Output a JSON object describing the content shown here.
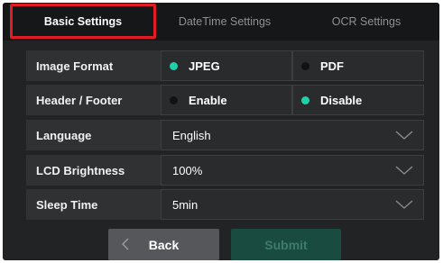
{
  "tabs": [
    {
      "label": "Basic Settings",
      "active": true
    },
    {
      "label": "DateTime Settings",
      "active": false
    },
    {
      "label": "OCR Settings",
      "active": false
    }
  ],
  "rows": {
    "image_format": {
      "label": "Image Format",
      "options": [
        {
          "label": "JPEG",
          "selected": true
        },
        {
          "label": "PDF",
          "selected": false
        }
      ]
    },
    "header_footer": {
      "label": "Header / Footer",
      "options": [
        {
          "label": "Enable",
          "selected": false
        },
        {
          "label": "Disable",
          "selected": true
        }
      ]
    },
    "language": {
      "label": "Language",
      "value": "English"
    },
    "lcd_brightness": {
      "label": "LCD Brightness",
      "value": "100%"
    },
    "sleep_time": {
      "label": "Sleep Time",
      "value": "5min"
    }
  },
  "buttons": {
    "back": "Back",
    "submit": "Submit"
  },
  "colors": {
    "accent": "#1fd0ac",
    "tab_highlight": "#e21c24",
    "background": "#222324"
  },
  "icons": {
    "dropdown": "chevron-down-icon",
    "back": "chevron-left-icon"
  }
}
